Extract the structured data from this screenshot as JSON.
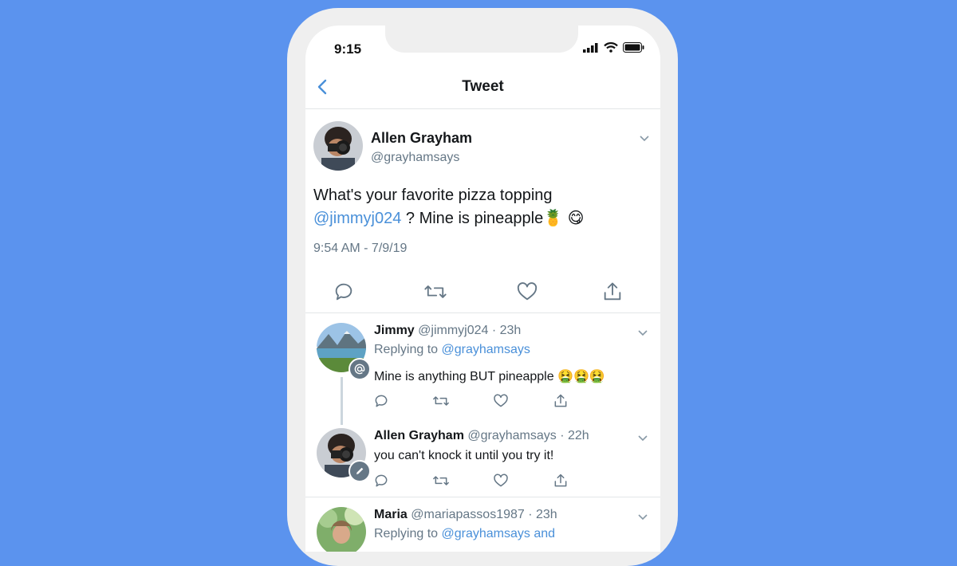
{
  "status": {
    "time": "9:15"
  },
  "nav": {
    "title": "Tweet"
  },
  "main_tweet": {
    "author_name": "Allen Grayham",
    "author_handle": "@grayhamsays",
    "text_line1": "What's your favorite pizza topping",
    "mention": "@jimmyj024",
    "text_line2_rest": " ? Mine is pineapple",
    "emoji": "🍍 😋",
    "timestamp": "9:54 AM - 7/9/19"
  },
  "replies": [
    {
      "name": "Jimmy",
      "meta": "@jimmyj024 · 23h",
      "replying_label": "Replying to",
      "replying_to": "@grayhamsays",
      "text": "Mine is anything BUT pineapple 🤮🤮🤮"
    },
    {
      "name": "Allen Grayham",
      "meta": "@grayhamsays · 22h",
      "text": "you can't knock it until you try it!"
    },
    {
      "name": "Maria",
      "meta": "@mariapassos1987 · 23h",
      "replying_label": "Replying to",
      "replying_to": "@grayhamsays and"
    }
  ],
  "colors": {
    "background": "#5b93ee",
    "accent": "#4a90d9",
    "muted": "#657786"
  },
  "icons": [
    "back-chevron-icon",
    "chevron-down-icon",
    "reply-icon",
    "retweet-icon",
    "like-icon",
    "share-icon",
    "signal-icon",
    "wifi-icon",
    "battery-icon"
  ]
}
